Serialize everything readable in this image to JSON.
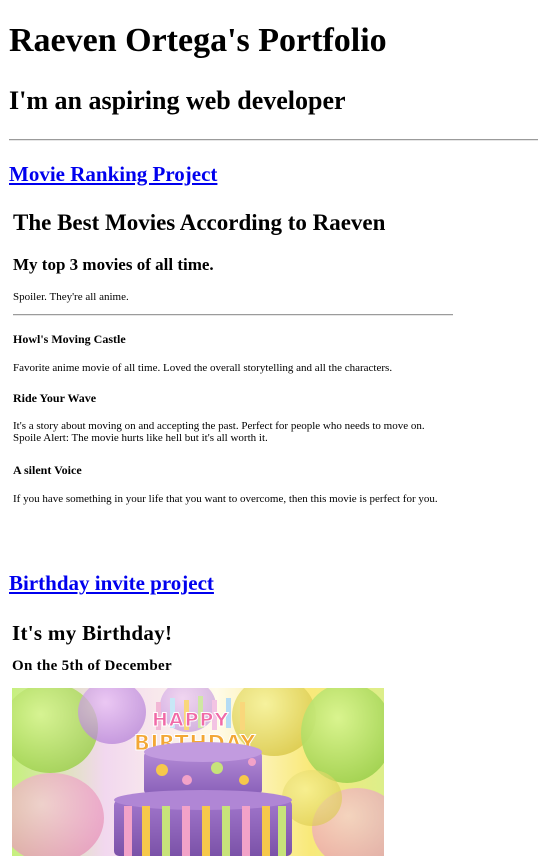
{
  "header": {
    "title": "Raeven Ortega's Portfolio",
    "tagline": "I'm an aspiring web developer"
  },
  "projects": {
    "movie": {
      "link_label": "Movie Ranking Project",
      "title": "The Best Movies According to Raeven",
      "subtitle": "My top 3 movies of all time.",
      "spoiler": "Spoiler. They're all anime.",
      "movies": [
        {
          "title": "Howl's Moving Castle",
          "description": "Favorite anime movie of all time. Loved the overall storytelling and all the characters."
        },
        {
          "title": "Ride Your Wave",
          "description": "It's a story about moving on and accepting the past. Perfect for people who needs to move on. Spoile Alert: The movie hurts like hell but it's all worth it."
        },
        {
          "title": "A silent Voice",
          "description": "If you have something in your life that you want to overcome, then this movie is perfect for you."
        }
      ]
    },
    "birthday": {
      "link_label": "Birthday invite project",
      "title": "It's my Birthday!",
      "subtitle": "On the 5th of December",
      "image_text": {
        "line1": "HAPPY",
        "line2": "BIRTHDAY"
      }
    }
  }
}
